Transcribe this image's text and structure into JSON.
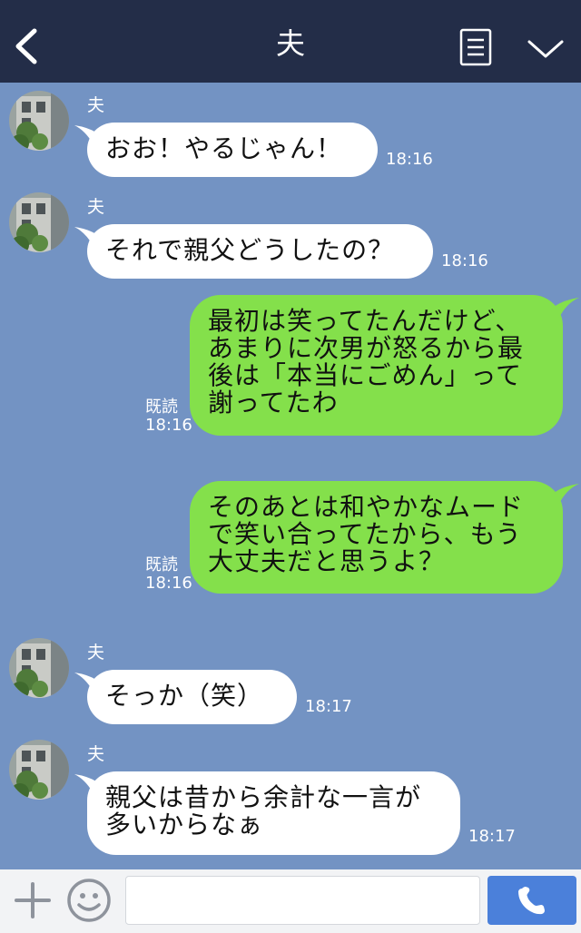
{
  "header": {
    "title": "夫",
    "background": "#232d48"
  },
  "colors": {
    "chat_background": "#7393c3",
    "outgoing_bubble": "#84e04b",
    "incoming_bubble": "#ffffff",
    "call_button": "#4b80da"
  },
  "messages": [
    {
      "direction": "in",
      "sender": "夫",
      "text": "おお！やるじゃん！",
      "time": "18:16"
    },
    {
      "direction": "in",
      "sender": "夫",
      "text": "それで親父どうしたの？",
      "time": "18:16"
    },
    {
      "direction": "out",
      "text": "最初は笑ってたんだけど、\nあまりに次男が怒るから最\n後は「本当にごめん」って\n謝ってたわ",
      "read": "既読",
      "time": "18:16"
    },
    {
      "direction": "out",
      "text": "そのあとは和やかなムード\nで笑い合ってたから、もう\n大丈夫だと思うよ？",
      "read": "既読",
      "time": "18:16"
    },
    {
      "direction": "in",
      "sender": "夫",
      "text": "そっか（笑）",
      "time": "18:17"
    },
    {
      "direction": "in",
      "sender": "夫",
      "text": "親父は昔から余計な一言が\n多いからなぁ",
      "time": "18:17"
    }
  ],
  "input": {
    "value": "",
    "placeholder": ""
  },
  "icons": {
    "back": "chevron-left-icon",
    "menu": "menu-list-icon",
    "collapse": "chevron-down-icon",
    "add": "plus-icon",
    "emoji": "smiley-icon",
    "call": "phone-icon"
  }
}
